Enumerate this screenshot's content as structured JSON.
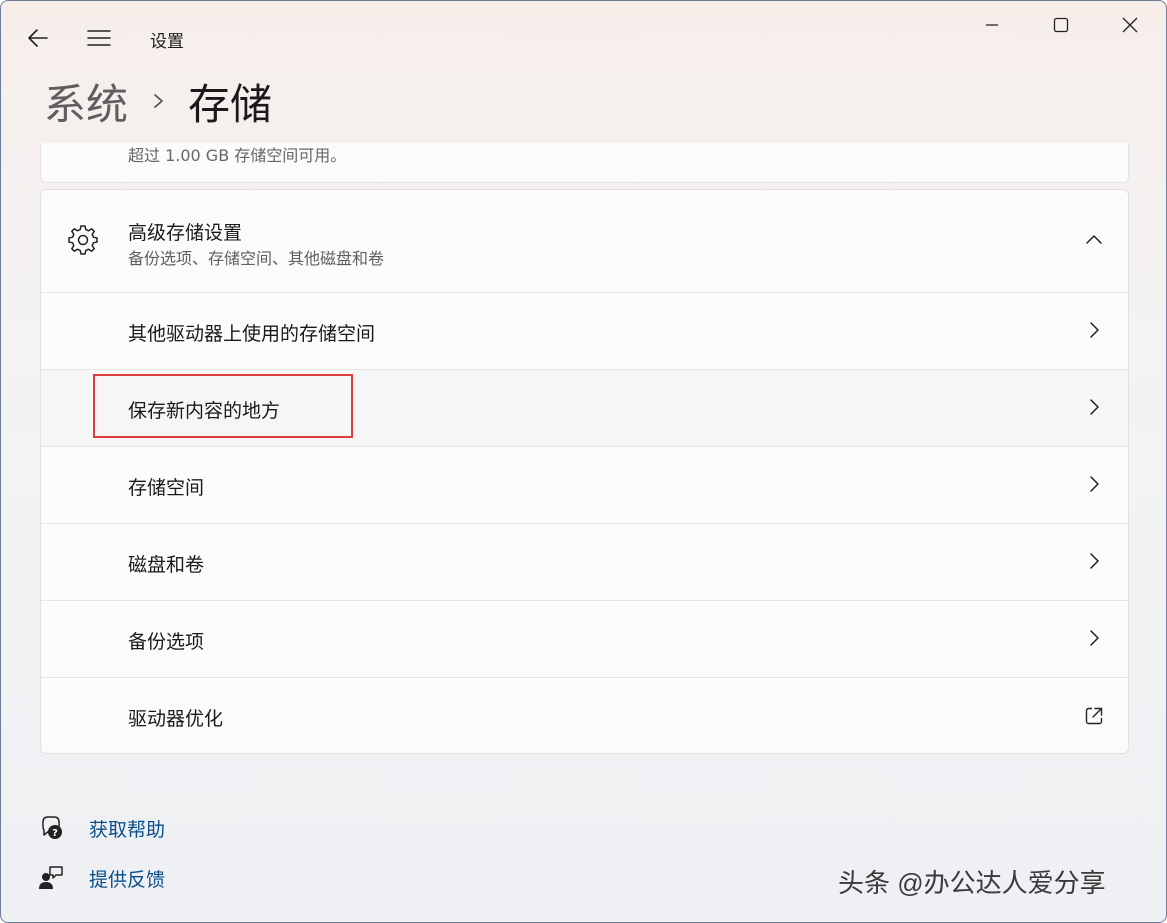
{
  "window": {
    "app_title": "设置",
    "back_icon": "back-arrow-icon",
    "menu_icon": "hamburger-menu-icon"
  },
  "window_controls": [
    "minimize-icon",
    "maximize-icon",
    "close-icon"
  ],
  "breadcrumb": {
    "parent": "系统",
    "current": "存储"
  },
  "previous_card": {
    "subtitle": "超过 1.00 GB 存储空间可用。"
  },
  "advanced": {
    "icon": "gear-icon",
    "title": "高级存储设置",
    "subtitle": "备份选项、存储空间、其他磁盘和卷",
    "expanded": true
  },
  "rows": [
    {
      "label": "其他驱动器上使用的存储空间",
      "icon": "chevron-right-icon"
    },
    {
      "label": "保存新内容的地方",
      "icon": "chevron-right-icon",
      "highlighted": true
    },
    {
      "label": "存储空间",
      "icon": "chevron-right-icon"
    },
    {
      "label": "磁盘和卷",
      "icon": "chevron-right-icon"
    },
    {
      "label": "备份选项",
      "icon": "chevron-right-icon"
    },
    {
      "label": "驱动器优化",
      "icon": "external-link-icon"
    }
  ],
  "links": {
    "help": "获取帮助",
    "feedback": "提供反馈"
  },
  "watermark": "头条 @办公达人爱分享",
  "colors": {
    "highlight_border": "#e23b3b",
    "link": "#0a4f8c"
  }
}
